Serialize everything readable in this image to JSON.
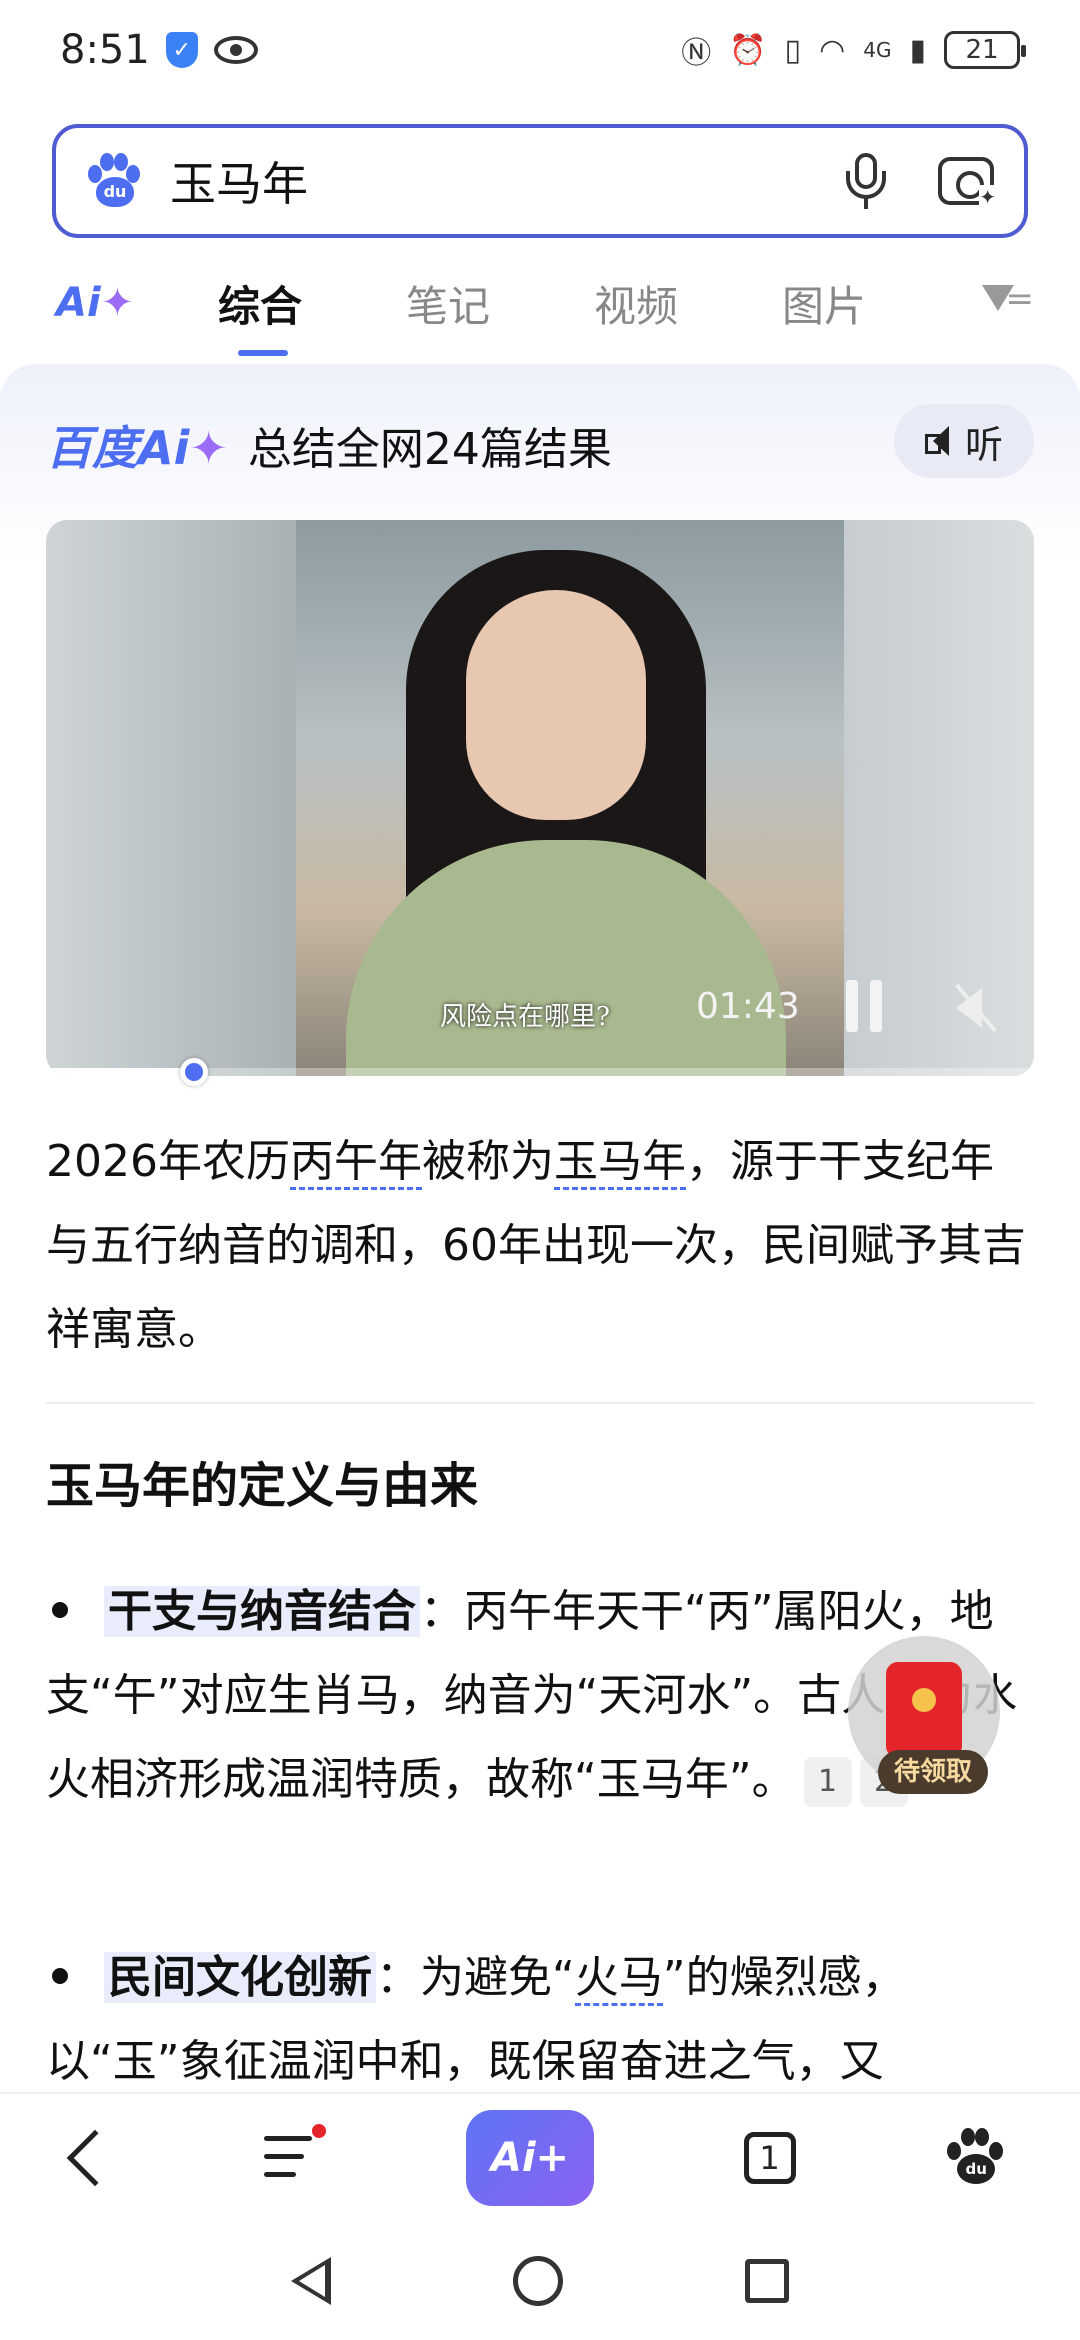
{
  "status_bar": {
    "time": "8:51",
    "network": "4G",
    "battery": "21",
    "icons": [
      "shield-check-icon",
      "eye-icon",
      "nfc-icon",
      "alarm-icon",
      "vibrate-icon",
      "wifi-icon",
      "signal-icon",
      "battery-icon"
    ]
  },
  "search": {
    "query": "玉马年",
    "icons": [
      "baidu-paw-icon",
      "mic-icon",
      "camera-search-icon"
    ]
  },
  "tabs": {
    "ai_label": "Ai",
    "items": [
      "综合",
      "笔记",
      "视频",
      "图片"
    ],
    "active": "综合"
  },
  "ai_card": {
    "brand": "百度Ai",
    "summary": "总结全网24篇结果",
    "listen_label": "听"
  },
  "video": {
    "caption": "风险点在哪里?",
    "time": "01:43",
    "progress_fraction": 0.15
  },
  "answer": {
    "para_before_1": "2026年农历",
    "link_1": "丙午年",
    "para_mid": "被称为",
    "link_2": "玉马年",
    "para_after": "，源于干支纪年与五行纳音的调和，60年出现一次，民间赋予其吉祥寓意。",
    "section_title": "玉马年的定义与由来",
    "bullet_1": {
      "keyword": "干支与纳音结合",
      "text_a": "：丙午年天干“丙”属阳火，地支“午”对应生肖马，纳音为“天河水”。古人认为水火相济形成温润特质，故称“玉马年”。",
      "cites": [
        "1",
        "2"
      ]
    },
    "bullet_2": {
      "keyword": "民间文化创新",
      "text_a": "：为避免“",
      "link": "火马",
      "text_b": "”的燥烈感，以“玉”象征温润中和，既保留奋进之气，又"
    }
  },
  "red_packet": {
    "label": "待领取"
  },
  "bottom_nav": {
    "ai_label": "Ai+",
    "tab_count": "1"
  },
  "colors": {
    "brand_blue": "#4e6ef2",
    "accent_purple": "#9b6cf5",
    "packet_red": "#e4252b"
  }
}
